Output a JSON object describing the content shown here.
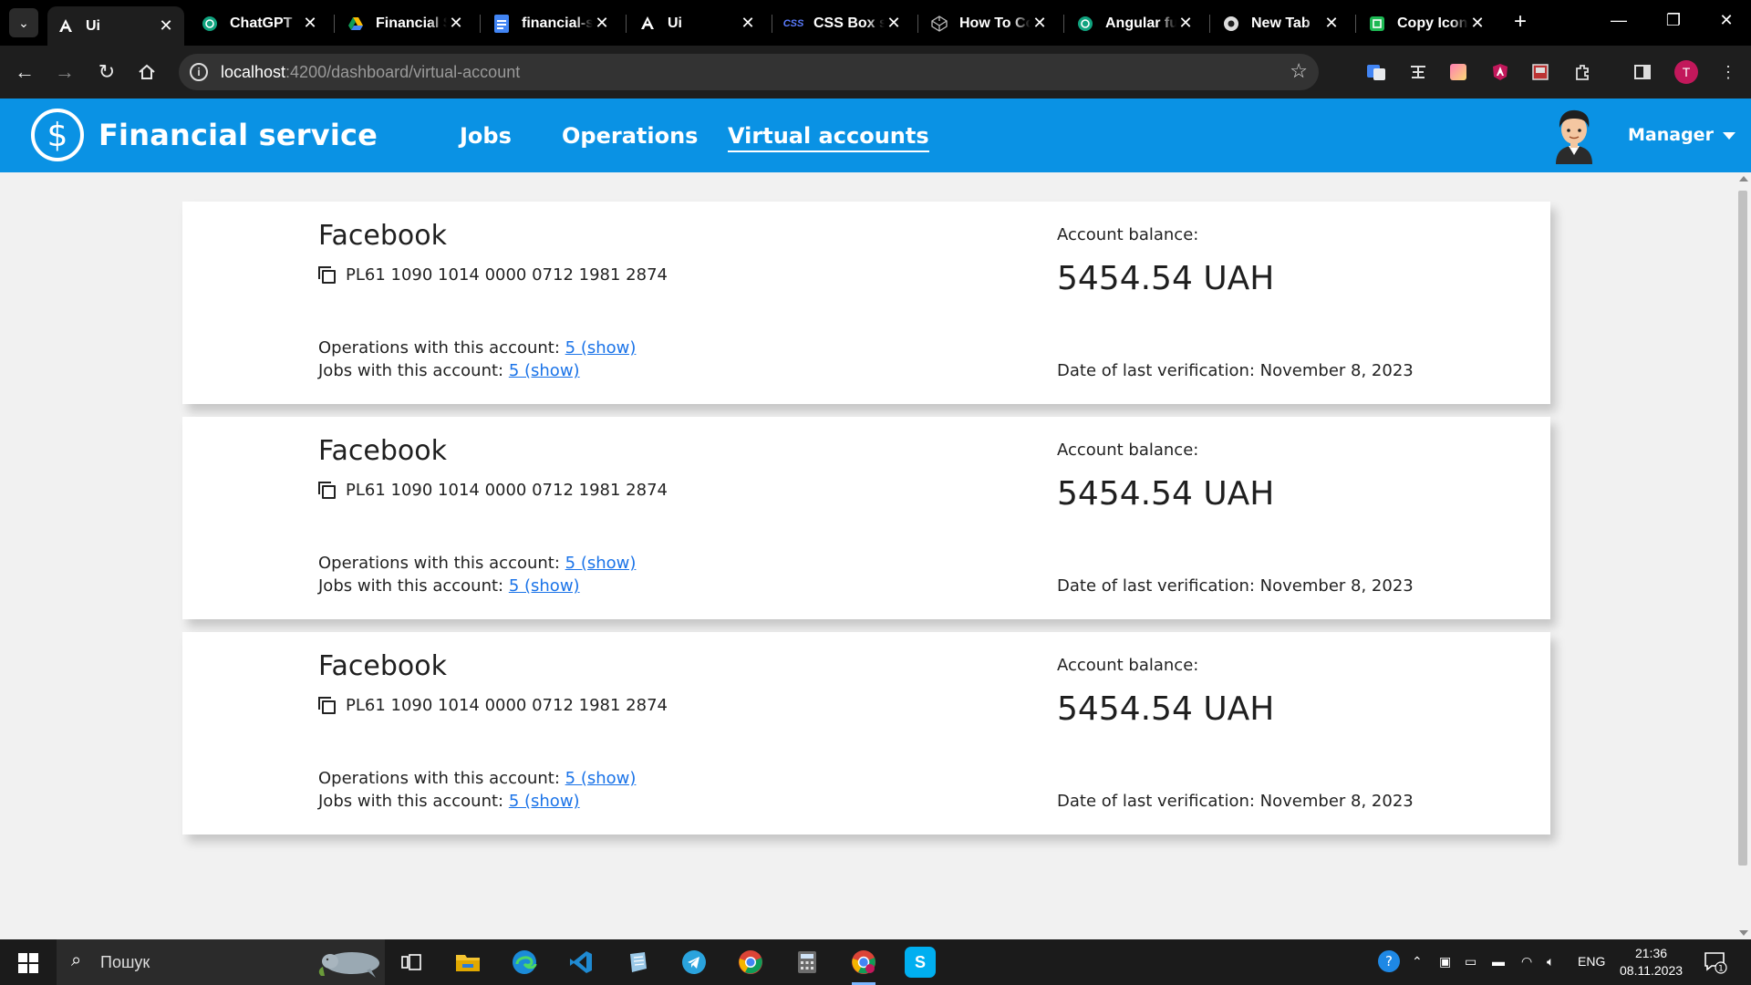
{
  "browser": {
    "tabs": [
      {
        "title": "Ui",
        "favicon": "angular-icon",
        "active": true
      },
      {
        "title": "ChatGPT",
        "favicon": "chatgpt-icon"
      },
      {
        "title": "Financial S",
        "favicon": "google-drive-icon"
      },
      {
        "title": "financial-s",
        "favicon": "google-docs-icon"
      },
      {
        "title": "Ui",
        "favicon": "angular-icon"
      },
      {
        "title": "CSS Box sh",
        "favicon": "css-icon"
      },
      {
        "title": "How To Co",
        "favicon": "codepen-icon"
      },
      {
        "title": "Angular fu",
        "favicon": "chatgpt-icon"
      },
      {
        "title": "New Tab",
        "favicon": "chrome-icon"
      },
      {
        "title": "Copy Icon",
        "favicon": "copy-icon-site"
      }
    ],
    "favicon_labels": {
      "css": "CSS"
    },
    "close_glyph": "✕",
    "new_tab_glyph": "+",
    "url_host": "localhost",
    "url_rest": ":4200/dashboard/virtual-account",
    "profile_initial": "T"
  },
  "app": {
    "brand": "Financial service",
    "brand_logo_glyph": "$",
    "nav": [
      {
        "label": "Jobs",
        "active": false
      },
      {
        "label": "Operations",
        "active": false
      },
      {
        "label": "Virtual accounts",
        "active": true
      }
    ],
    "user_menu": "Manager",
    "colors": {
      "header": "#0a92e4",
      "link": "#1a73e8"
    }
  },
  "accounts": [
    {
      "name": "Facebook",
      "iban": "PL61 1090 1014 0000 0712 1981 2874",
      "ops_label": "Operations with this account: ",
      "ops_link": "5 (show)",
      "jobs_label": "Jobs with this account: ",
      "jobs_link": "5 (show)",
      "balance_label": "Account balance:",
      "balance": "5454.54 UAH",
      "verification": "Date of last verification: November 8, 2023"
    },
    {
      "name": "Facebook",
      "iban": "PL61 1090 1014 0000 0712 1981 2874",
      "ops_label": "Operations with this account: ",
      "ops_link": "5 (show)",
      "jobs_label": "Jobs with this account: ",
      "jobs_link": "5 (show)",
      "balance_label": "Account balance:",
      "balance": "5454.54 UAH",
      "verification": "Date of last verification: November 8, 2023"
    },
    {
      "name": "Facebook",
      "iban": "PL61 1090 1014 0000 0712 1981 2874",
      "ops_label": "Operations with this account: ",
      "ops_link": "5 (show)",
      "jobs_label": "Jobs with this account: ",
      "jobs_link": "5 (show)",
      "balance_label": "Account balance:",
      "balance": "5454.54 UAH",
      "verification": "Date of last verification: November 8, 2023"
    }
  ],
  "taskbar": {
    "search_placeholder": "Пошук",
    "apps": [
      "task-view",
      "file-explorer",
      "edge",
      "vscode",
      "notepad",
      "telegram",
      "chrome",
      "calculator",
      "chrome-profile",
      "skype"
    ],
    "skype_letter": "S",
    "language": "ENG",
    "time": "21:36",
    "date": "08.11.2023",
    "notification_count": "1"
  }
}
